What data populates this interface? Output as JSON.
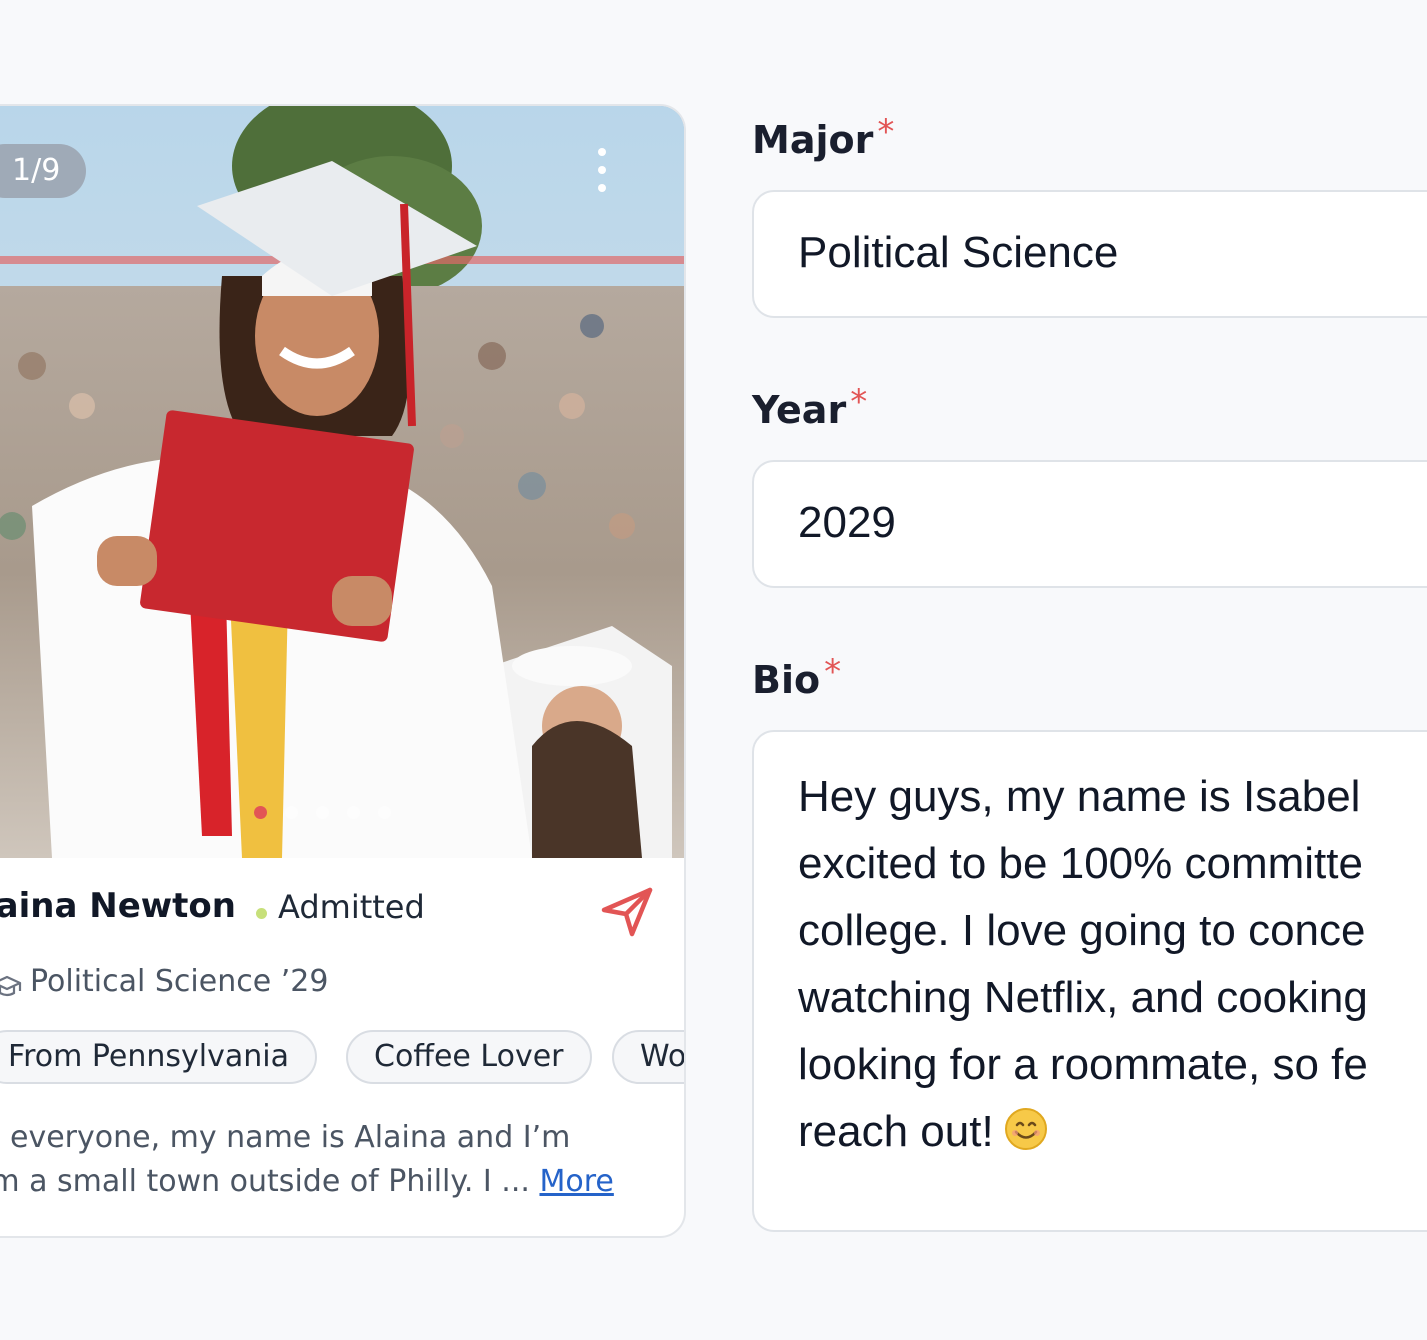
{
  "card": {
    "photo_counter": "1/9",
    "menu_icon": "more-vertical-icon",
    "carousel": {
      "total": 5,
      "active": 0,
      "accent": "#e25555"
    },
    "name": "laina Newton",
    "status_color": "#c7e07a",
    "status": "Admitted",
    "send_icon": "send-icon",
    "major_icon": "graduation-cap-icon",
    "major_year": "Political Science ’29",
    "tags": [
      "From Pennsylvania",
      "Coffee Lover",
      "Wo"
    ],
    "bio_line1": "everyone, my name is Alaina and I’m",
    "bio_line2": "om a small town outside of Philly. I ...",
    "more_label": "More",
    "link_color": "#2563c9"
  },
  "form": {
    "major_label": "Major",
    "major_value": "Political Science",
    "year_label": "Year",
    "year_value": "2029",
    "bio_label": "Bio",
    "required_marker": "*",
    "required_color": "#e25555",
    "bio_lines": [
      "Hey guys, my name is Isabel",
      "excited to be 100% committe",
      "college. I love going to conce",
      "watching Netflix, and cooking",
      "looking for a roommate, so fe",
      "reach out!"
    ],
    "bio_emoji_icon": "smiling-face-icon"
  }
}
